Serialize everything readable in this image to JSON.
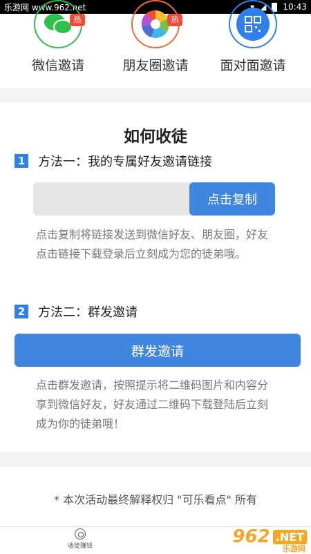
{
  "status": {
    "site_watermark": "乐游网 www.962.net",
    "time": "10:43"
  },
  "share": [
    {
      "label": "微信邀请",
      "badge": "热",
      "color": "#2fbf4c",
      "icon": "wechat-icon"
    },
    {
      "label": "朋友圈邀请",
      "badge": "热",
      "color": "#f06a3a",
      "icon": "moments-icon"
    },
    {
      "label": "面对面邀请",
      "badge": "",
      "color": "#2f80ed",
      "icon": "qrcode-icon"
    }
  ],
  "card": {
    "title": "如何收徒",
    "method1": {
      "num": "1",
      "label": "方法一：我的专属好友邀请链接",
      "copy_button": "点击复制",
      "desc": "点击复制将链接发送到微信好友、朋友圈，好友点击链接下载登录后立刻成为您的徒弟哦。"
    },
    "method2": {
      "num": "2",
      "label": "方法二：群发邀请",
      "button": "群发邀请",
      "desc": "点击群发邀请，按照提示将二维码图片和内容分享到微信好友，好友通过二维码下载登陆后立刻成为你的徒弟哦！"
    }
  },
  "footnote": "* 本次活动最终解释权归 \"可乐看点\" 所有",
  "tabbar": {
    "tab1": "收徒赚钱"
  },
  "watermark": {
    "num": "962",
    "net": ".NET",
    "text": "乐游网"
  },
  "colors": {
    "accent": "#3f86e0",
    "divider": "#f3f3f3"
  }
}
